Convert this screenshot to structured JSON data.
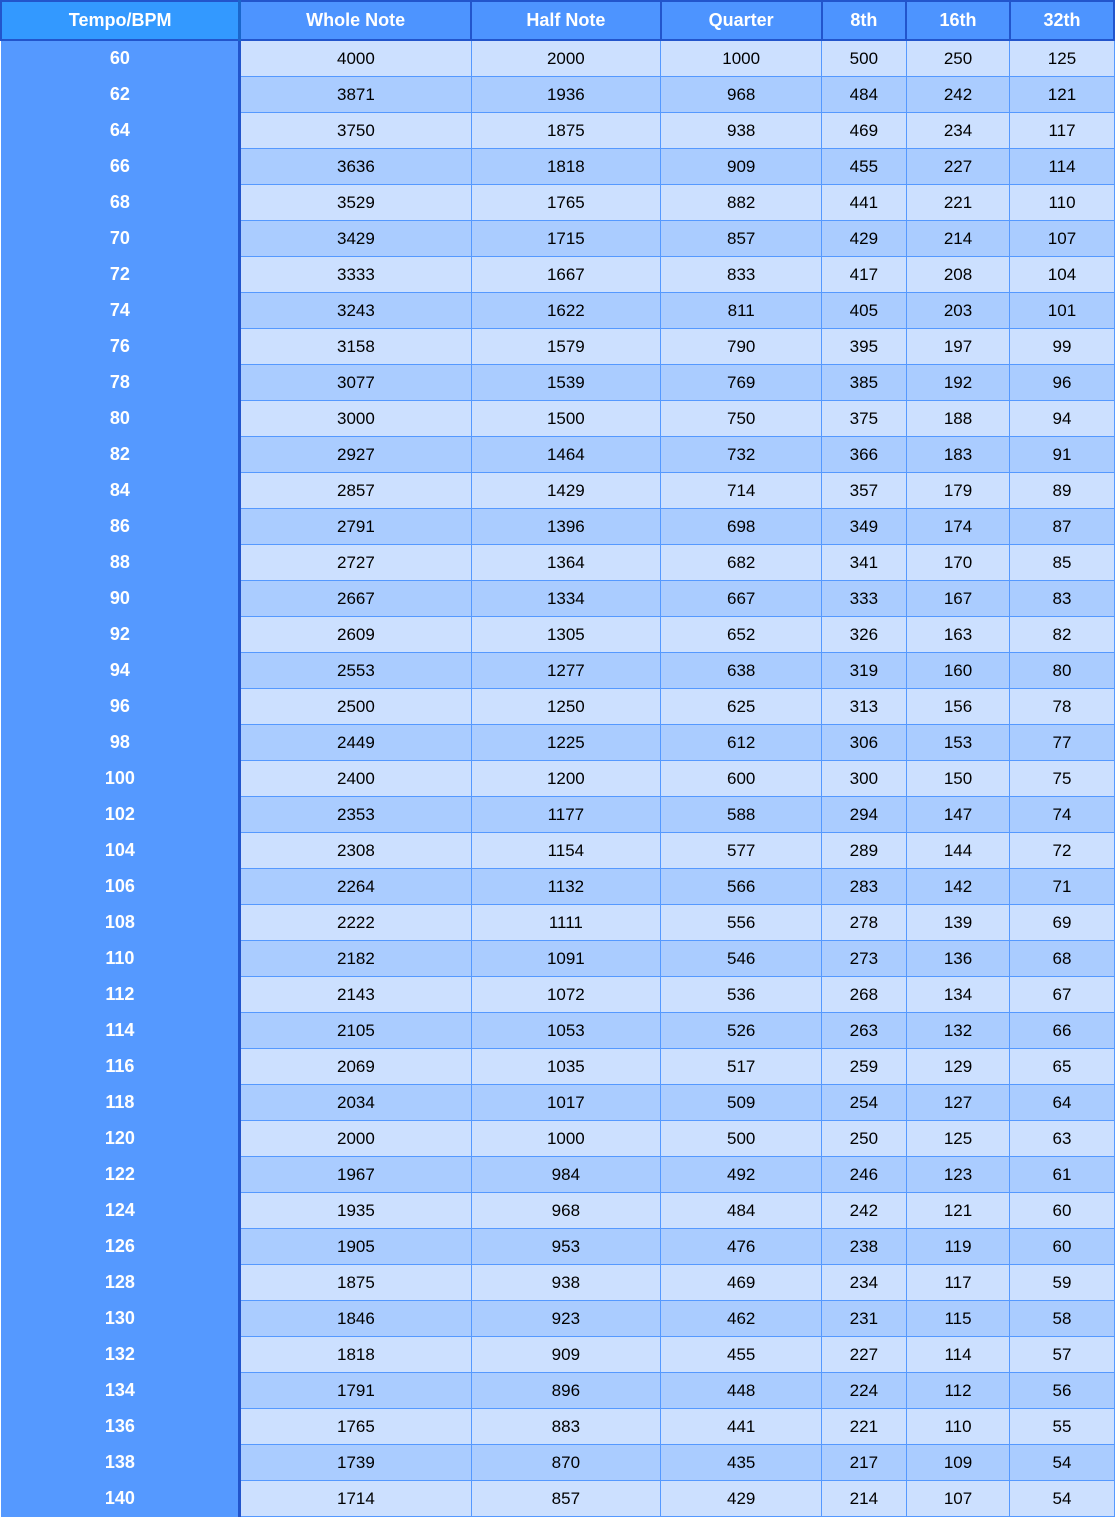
{
  "headers": [
    "Tempo/BPM",
    "Whole Note",
    "Half Note",
    "Quarter",
    "8th",
    "16th",
    "32th"
  ],
  "rows": [
    [
      60,
      4000,
      2000,
      1000,
      500,
      250,
      125
    ],
    [
      62,
      3871,
      1936,
      968,
      484,
      242,
      121
    ],
    [
      64,
      3750,
      1875,
      938,
      469,
      234,
      117
    ],
    [
      66,
      3636,
      1818,
      909,
      455,
      227,
      114
    ],
    [
      68,
      3529,
      1765,
      882,
      441,
      221,
      110
    ],
    [
      70,
      3429,
      1715,
      857,
      429,
      214,
      107
    ],
    [
      72,
      3333,
      1667,
      833,
      417,
      208,
      104
    ],
    [
      74,
      3243,
      1622,
      811,
      405,
      203,
      101
    ],
    [
      76,
      3158,
      1579,
      790,
      395,
      197,
      99
    ],
    [
      78,
      3077,
      1539,
      769,
      385,
      192,
      96
    ],
    [
      80,
      3000,
      1500,
      750,
      375,
      188,
      94
    ],
    [
      82,
      2927,
      1464,
      732,
      366,
      183,
      91
    ],
    [
      84,
      2857,
      1429,
      714,
      357,
      179,
      89
    ],
    [
      86,
      2791,
      1396,
      698,
      349,
      174,
      87
    ],
    [
      88,
      2727,
      1364,
      682,
      341,
      170,
      85
    ],
    [
      90,
      2667,
      1334,
      667,
      333,
      167,
      83
    ],
    [
      92,
      2609,
      1305,
      652,
      326,
      163,
      82
    ],
    [
      94,
      2553,
      1277,
      638,
      319,
      160,
      80
    ],
    [
      96,
      2500,
      1250,
      625,
      313,
      156,
      78
    ],
    [
      98,
      2449,
      1225,
      612,
      306,
      153,
      77
    ],
    [
      100,
      2400,
      1200,
      600,
      300,
      150,
      75
    ],
    [
      102,
      2353,
      1177,
      588,
      294,
      147,
      74
    ],
    [
      104,
      2308,
      1154,
      577,
      289,
      144,
      72
    ],
    [
      106,
      2264,
      1132,
      566,
      283,
      142,
      71
    ],
    [
      108,
      2222,
      1111,
      556,
      278,
      139,
      69
    ],
    [
      110,
      2182,
      1091,
      546,
      273,
      136,
      68
    ],
    [
      112,
      2143,
      1072,
      536,
      268,
      134,
      67
    ],
    [
      114,
      2105,
      1053,
      526,
      263,
      132,
      66
    ],
    [
      116,
      2069,
      1035,
      517,
      259,
      129,
      65
    ],
    [
      118,
      2034,
      1017,
      509,
      254,
      127,
      64
    ],
    [
      120,
      2000,
      1000,
      500,
      250,
      125,
      63
    ],
    [
      122,
      1967,
      984,
      492,
      246,
      123,
      61
    ],
    [
      124,
      1935,
      968,
      484,
      242,
      121,
      60
    ],
    [
      126,
      1905,
      953,
      476,
      238,
      119,
      60
    ],
    [
      128,
      1875,
      938,
      469,
      234,
      117,
      59
    ],
    [
      130,
      1846,
      923,
      462,
      231,
      115,
      58
    ],
    [
      132,
      1818,
      909,
      455,
      227,
      114,
      57
    ],
    [
      134,
      1791,
      896,
      448,
      224,
      112,
      56
    ],
    [
      136,
      1765,
      883,
      441,
      221,
      110,
      55
    ],
    [
      138,
      1739,
      870,
      435,
      217,
      109,
      54
    ],
    [
      140,
      1714,
      857,
      429,
      214,
      107,
      54
    ]
  ]
}
